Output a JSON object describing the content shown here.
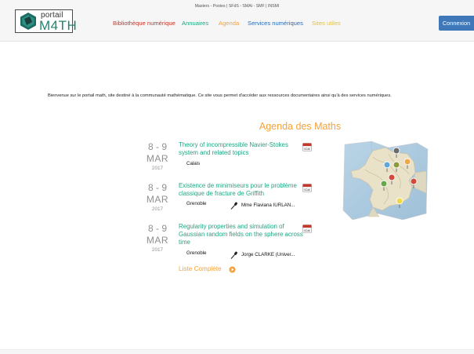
{
  "header": {
    "logo_line1": "portail",
    "logo_line2": "M4TH",
    "societies": "Masters - Postes | SFdS - SMAI - SMF | INSMI",
    "nav": {
      "bibliotheque": "Bibliothèque numérique",
      "annuaires": "Annuaires",
      "agenda": "Agenda",
      "services": "Services numériques",
      "sites": "Sites utiles"
    },
    "connexion": "Connexion"
  },
  "welcome": "Bienvenue sur le portail math, site destiné à la communauté mathématique. Ce site vous permet d'accéder aux ressources documentaires ainsi qu'à des services numériques.",
  "agenda": {
    "title": "Agenda des Maths",
    "ical_label": "iCal",
    "events": [
      {
        "day": "8 - 9",
        "month": "MAR",
        "year": "2017",
        "title": "Theory of incompressible Navier-Stokes system and related topics",
        "city": "Calais",
        "speaker": ""
      },
      {
        "day": "8 - 9",
        "month": "MAR",
        "year": "2017",
        "title": "Existence de minimiseurs pour le problème classique de fracture de Griffith",
        "city": "Grenoble",
        "speaker": "Mme Flaviana IURLAN..."
      },
      {
        "day": "8 - 9",
        "month": "MAR",
        "year": "2017",
        "title": "Regularity properties and simulation of Gaussian random fields on the sphere across time",
        "city": "Grenoble",
        "speaker": "Jorge CLARKE (Univer..."
      }
    ],
    "full_list": "Liste Complète"
  },
  "colors": {
    "brand_teal": "#1fa582",
    "agenda_orange": "#f4a23c",
    "biblio_red": "#c0392b",
    "services_blue": "#2a6bb7",
    "sites_yellow": "#e3c23c",
    "connexion_blue": "#3f78b8"
  },
  "map": {
    "pin_colors": [
      "#6b6b6b",
      "#f0a64a",
      "#8c9a3a",
      "#5fa7d8",
      "#66a84a",
      "#d24a3a",
      "#eeda45"
    ]
  }
}
